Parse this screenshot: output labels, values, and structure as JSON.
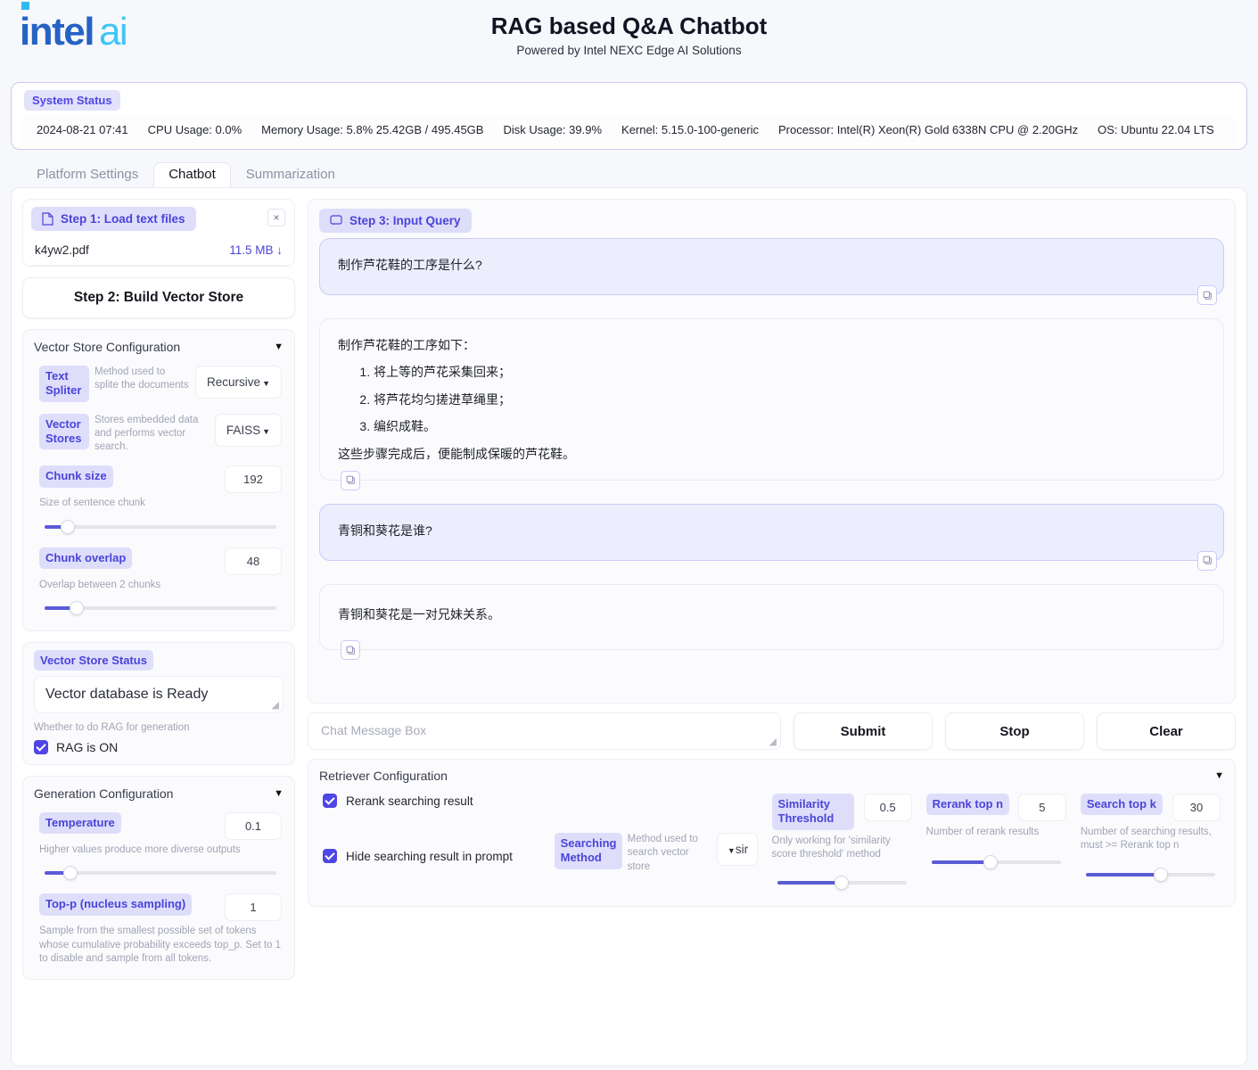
{
  "brand": {
    "intel": "intel",
    "ai": "ai"
  },
  "header": {
    "title": "RAG based Q&A Chatbot",
    "subtitle": "Powered by Intel NEXC Edge AI Solutions"
  },
  "system_status": {
    "badge": "System Status",
    "items": [
      "2024-08-21 07:41",
      "CPU Usage: 0.0%",
      "Memory Usage: 5.8% 25.42GB / 495.45GB",
      "Disk Usage: 39.9%",
      "Kernel: 5.15.0-100-generic",
      "Processor: Intel(R) Xeon(R) Gold 6338N CPU @ 2.20GHz",
      "OS: Ubuntu 22.04 LTS"
    ]
  },
  "tabs": [
    {
      "label": "Platform Settings",
      "active": false
    },
    {
      "label": "Chatbot",
      "active": true
    },
    {
      "label": "Summarization",
      "active": false
    }
  ],
  "step1": {
    "badge": "Step 1: Load text files",
    "file_icon": "file-icon",
    "close_icon": "close-icon",
    "file_name": "k4yw2.pdf",
    "file_size": "11.5 MB",
    "download_icon": "download-icon"
  },
  "step2": {
    "label": "Step 2: Build Vector Store"
  },
  "vector_store_config": {
    "title": "Vector Store Configuration",
    "caret": "▼",
    "text_spliter": {
      "label": "Text Spliter",
      "hint": "Method used to splite the documents",
      "value": "Recursive"
    },
    "vector_stores": {
      "label": "Vector Stores",
      "hint": "Stores embedded data and performs vector search.",
      "value": "FAISS"
    },
    "chunk_size": {
      "label": "Chunk size",
      "hint": "Size of sentence chunk",
      "value": "192",
      "slider_percent": 10
    },
    "chunk_overlap": {
      "label": "Chunk overlap",
      "hint": "Overlap between 2 chunks",
      "value": "48",
      "slider_percent": 14
    }
  },
  "vector_store_status": {
    "badge": "Vector Store Status",
    "message": "Vector database is Ready",
    "rag_hint": "Whether to do RAG for generation",
    "rag_toggle_label": "RAG is ON",
    "rag_checked": true
  },
  "generation_config": {
    "title": "Generation Configuration",
    "caret": "▼",
    "temperature": {
      "label": "Temperature",
      "hint": "Higher values produce more diverse outputs",
      "value": "0.1",
      "slider_percent": 11
    },
    "top_p": {
      "label": "Top-p (nucleus sampling)",
      "hint": "Sample from the smallest possible set of tokens whose cumulative probability exceeds top_p. Set to 1 to disable and sample from all tokens.",
      "value": "1"
    }
  },
  "step3": {
    "badge": "Step 3: Input Query",
    "chat_icon": "chat-icon"
  },
  "chat": {
    "messages": [
      {
        "role": "user",
        "text": "制作芦花鞋的工序是什么?"
      },
      {
        "role": "bot",
        "intro": "制作芦花鞋的工序如下：",
        "steps": [
          "将上等的芦花采集回来；",
          "将芦花均匀搓进草绳里；",
          "编织成鞋。"
        ],
        "outro": "这些步骤完成后，便能制成保暖的芦花鞋。"
      },
      {
        "role": "user",
        "text": "青铜和葵花是谁?"
      },
      {
        "role": "bot",
        "intro": "青铜和葵花是一对兄妹关系。",
        "steps": [],
        "outro": ""
      }
    ],
    "input_placeholder": "Chat Message Box",
    "input_value": "",
    "buttons": {
      "submit": "Submit",
      "stop": "Stop",
      "clear": "Clear"
    },
    "copy_icon": "copy-icon"
  },
  "retriever_config": {
    "title": "Retriever Configuration",
    "caret": "▼",
    "rerank_searching_result": {
      "label": "Rerank searching result",
      "checked": true
    },
    "hide_searching_result": {
      "label": "Hide searching result in prompt",
      "checked": true
    },
    "searching_method": {
      "label": "Searching Method",
      "hint": "Method used to search vector store",
      "value": "sir"
    },
    "similarity_threshold": {
      "label": "Similarity Threshold",
      "hint": "Only working for 'similarity score threshold' method",
      "value": "0.5",
      "slider_percent": 50
    },
    "rerank_top_n": {
      "label": "Rerank top n",
      "hint": "Number of rerank results",
      "value": "5",
      "slider_percent": 46
    },
    "search_top_k": {
      "label": "Search top k",
      "hint": "Number of searching results, must >= Rerank top n",
      "value": "30",
      "slider_percent": 58
    }
  },
  "colors": {
    "accent": "#4f46e5",
    "accent_soft": "#dedefb",
    "slider_fill": "#5b5bd6",
    "intel_blue": "#2563c4",
    "intel_cyan": "#3ec6f5",
    "user_bubble": "#edeefd",
    "user_bubble_border": "#c9cbf6"
  }
}
